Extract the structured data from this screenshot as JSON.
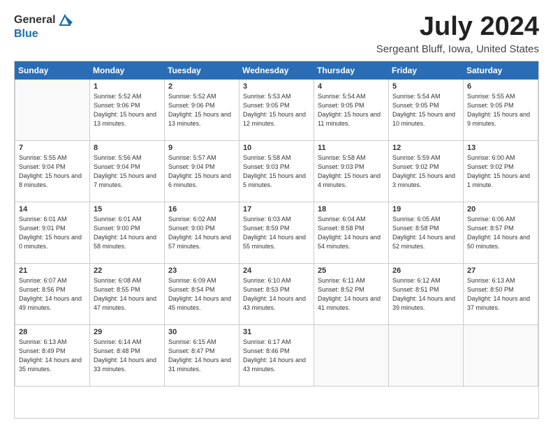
{
  "logo": {
    "general": "General",
    "blue": "Blue"
  },
  "title": "July 2024",
  "subtitle": "Sergeant Bluff, Iowa, United States",
  "days_of_week": [
    "Sunday",
    "Monday",
    "Tuesday",
    "Wednesday",
    "Thursday",
    "Friday",
    "Saturday"
  ],
  "weeks": [
    [
      {
        "num": "",
        "sunrise": "",
        "sunset": "",
        "daylight": ""
      },
      {
        "num": "1",
        "sunrise": "Sunrise: 5:52 AM",
        "sunset": "Sunset: 9:06 PM",
        "daylight": "Daylight: 15 hours and 13 minutes."
      },
      {
        "num": "2",
        "sunrise": "Sunrise: 5:52 AM",
        "sunset": "Sunset: 9:06 PM",
        "daylight": "Daylight: 15 hours and 13 minutes."
      },
      {
        "num": "3",
        "sunrise": "Sunrise: 5:53 AM",
        "sunset": "Sunset: 9:05 PM",
        "daylight": "Daylight: 15 hours and 12 minutes."
      },
      {
        "num": "4",
        "sunrise": "Sunrise: 5:54 AM",
        "sunset": "Sunset: 9:05 PM",
        "daylight": "Daylight: 15 hours and 11 minutes."
      },
      {
        "num": "5",
        "sunrise": "Sunrise: 5:54 AM",
        "sunset": "Sunset: 9:05 PM",
        "daylight": "Daylight: 15 hours and 10 minutes."
      },
      {
        "num": "6",
        "sunrise": "Sunrise: 5:55 AM",
        "sunset": "Sunset: 9:05 PM",
        "daylight": "Daylight: 15 hours and 9 minutes."
      }
    ],
    [
      {
        "num": "7",
        "sunrise": "Sunrise: 5:55 AM",
        "sunset": "Sunset: 9:04 PM",
        "daylight": "Daylight: 15 hours and 8 minutes."
      },
      {
        "num": "8",
        "sunrise": "Sunrise: 5:56 AM",
        "sunset": "Sunset: 9:04 PM",
        "daylight": "Daylight: 15 hours and 7 minutes."
      },
      {
        "num": "9",
        "sunrise": "Sunrise: 5:57 AM",
        "sunset": "Sunset: 9:04 PM",
        "daylight": "Daylight: 15 hours and 6 minutes."
      },
      {
        "num": "10",
        "sunrise": "Sunrise: 5:58 AM",
        "sunset": "Sunset: 9:03 PM",
        "daylight": "Daylight: 15 hours and 5 minutes."
      },
      {
        "num": "11",
        "sunrise": "Sunrise: 5:58 AM",
        "sunset": "Sunset: 9:03 PM",
        "daylight": "Daylight: 15 hours and 4 minutes."
      },
      {
        "num": "12",
        "sunrise": "Sunrise: 5:59 AM",
        "sunset": "Sunset: 9:02 PM",
        "daylight": "Daylight: 15 hours and 3 minutes."
      },
      {
        "num": "13",
        "sunrise": "Sunrise: 6:00 AM",
        "sunset": "Sunset: 9:02 PM",
        "daylight": "Daylight: 15 hours and 1 minute."
      }
    ],
    [
      {
        "num": "14",
        "sunrise": "Sunrise: 6:01 AM",
        "sunset": "Sunset: 9:01 PM",
        "daylight": "Daylight: 15 hours and 0 minutes."
      },
      {
        "num": "15",
        "sunrise": "Sunrise: 6:01 AM",
        "sunset": "Sunset: 9:00 PM",
        "daylight": "Daylight: 14 hours and 58 minutes."
      },
      {
        "num": "16",
        "sunrise": "Sunrise: 6:02 AM",
        "sunset": "Sunset: 9:00 PM",
        "daylight": "Daylight: 14 hours and 57 minutes."
      },
      {
        "num": "17",
        "sunrise": "Sunrise: 6:03 AM",
        "sunset": "Sunset: 8:59 PM",
        "daylight": "Daylight: 14 hours and 55 minutes."
      },
      {
        "num": "18",
        "sunrise": "Sunrise: 6:04 AM",
        "sunset": "Sunset: 8:58 PM",
        "daylight": "Daylight: 14 hours and 54 minutes."
      },
      {
        "num": "19",
        "sunrise": "Sunrise: 6:05 AM",
        "sunset": "Sunset: 8:58 PM",
        "daylight": "Daylight: 14 hours and 52 minutes."
      },
      {
        "num": "20",
        "sunrise": "Sunrise: 6:06 AM",
        "sunset": "Sunset: 8:57 PM",
        "daylight": "Daylight: 14 hours and 50 minutes."
      }
    ],
    [
      {
        "num": "21",
        "sunrise": "Sunrise: 6:07 AM",
        "sunset": "Sunset: 8:56 PM",
        "daylight": "Daylight: 14 hours and 49 minutes."
      },
      {
        "num": "22",
        "sunrise": "Sunrise: 6:08 AM",
        "sunset": "Sunset: 8:55 PM",
        "daylight": "Daylight: 14 hours and 47 minutes."
      },
      {
        "num": "23",
        "sunrise": "Sunrise: 6:09 AM",
        "sunset": "Sunset: 8:54 PM",
        "daylight": "Daylight: 14 hours and 45 minutes."
      },
      {
        "num": "24",
        "sunrise": "Sunrise: 6:10 AM",
        "sunset": "Sunset: 8:53 PM",
        "daylight": "Daylight: 14 hours and 43 minutes."
      },
      {
        "num": "25",
        "sunrise": "Sunrise: 6:11 AM",
        "sunset": "Sunset: 8:52 PM",
        "daylight": "Daylight: 14 hours and 41 minutes."
      },
      {
        "num": "26",
        "sunrise": "Sunrise: 6:12 AM",
        "sunset": "Sunset: 8:51 PM",
        "daylight": "Daylight: 14 hours and 39 minutes."
      },
      {
        "num": "27",
        "sunrise": "Sunrise: 6:13 AM",
        "sunset": "Sunset: 8:50 PM",
        "daylight": "Daylight: 14 hours and 37 minutes."
      }
    ],
    [
      {
        "num": "28",
        "sunrise": "Sunrise: 6:13 AM",
        "sunset": "Sunset: 8:49 PM",
        "daylight": "Daylight: 14 hours and 35 minutes."
      },
      {
        "num": "29",
        "sunrise": "Sunrise: 6:14 AM",
        "sunset": "Sunset: 8:48 PM",
        "daylight": "Daylight: 14 hours and 33 minutes."
      },
      {
        "num": "30",
        "sunrise": "Sunrise: 6:15 AM",
        "sunset": "Sunset: 8:47 PM",
        "daylight": "Daylight: 14 hours and 31 minutes."
      },
      {
        "num": "31",
        "sunrise": "Sunrise: 6:17 AM",
        "sunset": "Sunset: 8:46 PM",
        "daylight": "Daylight: 14 hours and 43 minutes."
      },
      {
        "num": "",
        "sunrise": "",
        "sunset": "",
        "daylight": ""
      },
      {
        "num": "",
        "sunrise": "",
        "sunset": "",
        "daylight": ""
      },
      {
        "num": "",
        "sunrise": "",
        "sunset": "",
        "daylight": ""
      }
    ]
  ]
}
